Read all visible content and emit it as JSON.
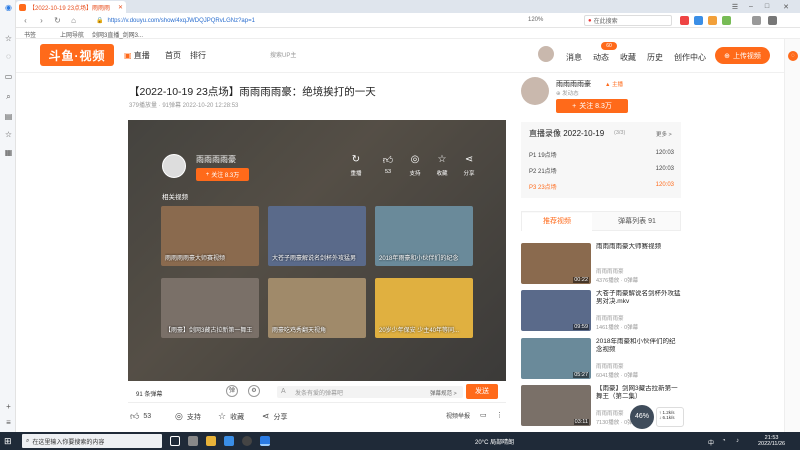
{
  "browser": {
    "tab_title": "【2022-10-19 23点场】雨雨雨",
    "url": "https://v.douyu.com/show/4xqJWDQJPQRvLGNz?ap=1",
    "zoom": "120%",
    "search_placeholder": "在此搜索",
    "bookmarks": [
      "书签",
      "上网导航",
      "剑网3直播_剑网3..."
    ]
  },
  "site": {
    "logo": "斗鱼·视频",
    "nav": [
      "直播",
      "首页",
      "排行"
    ],
    "search_placeholder": "搜索UP主",
    "header_items": [
      {
        "label": "消息",
        "icon": "message-icon"
      },
      {
        "label": "动态",
        "icon": "bell-icon"
      },
      {
        "label": "收藏",
        "icon": "star-icon"
      },
      {
        "label": "历史",
        "icon": "history-icon"
      },
      {
        "label": "创作中心",
        "icon": "creator-icon"
      }
    ],
    "badge": "60",
    "upload": "上传视频"
  },
  "video": {
    "title": "【2022-10-19 23点场】雨雨雨雨豪：绝境挨打的一天",
    "meta": "379播放量 · 91弹幕   2022-10-20 12:28:53"
  },
  "player": {
    "anchor": "雨雨雨雨豪",
    "follow": "关注 8.3万",
    "actions": [
      {
        "label": "重播",
        "icon": "replay-icon"
      },
      {
        "label": "53",
        "icon": "like-icon"
      },
      {
        "label": "支持",
        "icon": "support-icon"
      },
      {
        "label": "收藏",
        "icon": "favorite-icon"
      },
      {
        "label": "分享",
        "icon": "share-icon"
      }
    ],
    "related_heading": "相关视频",
    "related": [
      {
        "title": "雨雨雨雨豪大师赛视频",
        "color": "#8a6a4e"
      },
      {
        "title": "大苍子雨豪解说名剑杯外攻猛男",
        "color": "#5a6a8a"
      },
      {
        "title": "2018年雨豪和小伙伴们的纪念",
        "color": "#6a8a9a"
      },
      {
        "title": "【雨豪】剑网3藏古拉新第一舞王",
        "color": "#7a7068"
      },
      {
        "title": "雨豪吃鸡秀翻天视角",
        "color": "#a08a6a"
      },
      {
        "title": "20岁少年保安 少主40年等同...",
        "color": "#e0b040"
      }
    ]
  },
  "danmu": {
    "count": "91 条弹幕",
    "input_placeholder": "发条有爱的弹幕吧",
    "rule": "弹幕规范 >",
    "send": "发送"
  },
  "actions": {
    "like": "53",
    "support": "支持",
    "favorite": "收藏",
    "share": "分享",
    "report": "视频举报"
  },
  "sidebar": {
    "up_name": "雨雨雨雨豪",
    "up_level": "▲ 主播",
    "up_fans": "⊕ 发动态",
    "follow": "关注 8.3万",
    "recap_title": "直播录像 2022-10-19",
    "recap_count": "(3/3)",
    "recap_more": "更多 >",
    "recap_items": [
      {
        "name": "P1 19点场",
        "time": "120:03",
        "active": false
      },
      {
        "name": "P2 21点场",
        "time": "120:03",
        "active": false
      },
      {
        "name": "P3 23点场",
        "time": "120:03",
        "active": true
      }
    ],
    "tabs": [
      "推荐视频",
      "弹幕列表 91"
    ],
    "recommended": [
      {
        "title": "雨雨雨雨豪大师赛视频",
        "author": "雨雨雨雨豪",
        "views": "4376播放 · 0弹幕",
        "duration": "00:22",
        "color": "#8a6a4e"
      },
      {
        "title": "大苍子雨豪解说名剑杯外攻猛男对决.mkv",
        "author": "雨雨雨雨豪",
        "views": "1461播放 · 0弹幕",
        "duration": "09:59",
        "color": "#5a6a8a"
      },
      {
        "title": "2018年雨豪和小伙伴们的纪念视频",
        "author": "雨雨雨雨豪",
        "views": "6041播放 · 0弹幕",
        "duration": "05:27",
        "color": "#6a8a9a"
      },
      {
        "title": "【雨豪】剑网3藏古拉新第一舞王（第二集）",
        "author": "雨雨雨雨豪",
        "views": "7130播放 · 0弹幕",
        "duration": "03:11",
        "color": "#7a7068"
      }
    ]
  },
  "float": {
    "speed": "46%",
    "up": "↑ 1.2k/s",
    "down": "↓ 6.1k/s"
  },
  "taskbar": {
    "search": "在这里输入你要搜索的内容",
    "weather": "20°C 局部晴朗",
    "time": "21:53",
    "date": "2022/11/26"
  }
}
